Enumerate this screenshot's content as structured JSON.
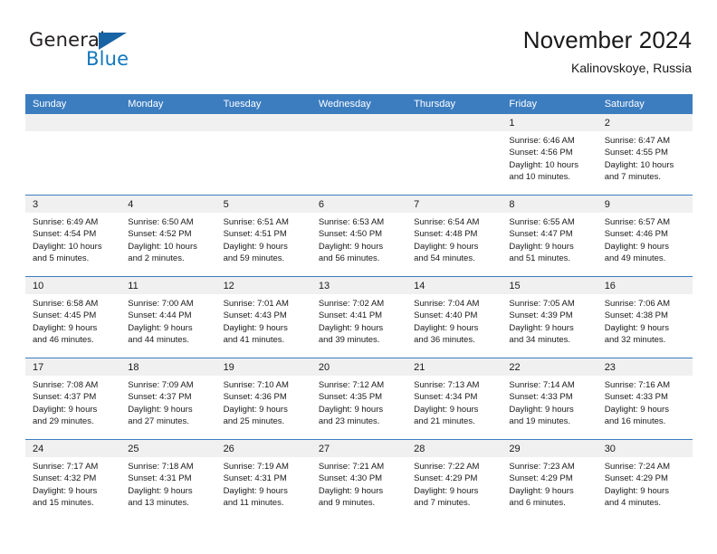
{
  "brand": {
    "name_part1": "General",
    "name_part2": "Blue",
    "triangle_color": "#1763a4",
    "blue_color": "#1278be"
  },
  "header": {
    "title": "November 2024",
    "subtitle": "Kalinovskoye, Russia"
  },
  "theme": {
    "header_blue": "#3c7dc0",
    "daynum_band": "#f0f0f0",
    "text": "#1a1a1a"
  },
  "weekdays": [
    "Sunday",
    "Monday",
    "Tuesday",
    "Wednesday",
    "Thursday",
    "Friday",
    "Saturday"
  ],
  "weeks": [
    [
      {
        "day": "",
        "sunrise": "",
        "sunset": "",
        "daylight": ""
      },
      {
        "day": "",
        "sunrise": "",
        "sunset": "",
        "daylight": ""
      },
      {
        "day": "",
        "sunrise": "",
        "sunset": "",
        "daylight": ""
      },
      {
        "day": "",
        "sunrise": "",
        "sunset": "",
        "daylight": ""
      },
      {
        "day": "",
        "sunrise": "",
        "sunset": "",
        "daylight": ""
      },
      {
        "day": "1",
        "sunrise": "Sunrise: 6:46 AM",
        "sunset": "Sunset: 4:56 PM",
        "daylight": "Daylight: 10 hours and 10 minutes."
      },
      {
        "day": "2",
        "sunrise": "Sunrise: 6:47 AM",
        "sunset": "Sunset: 4:55 PM",
        "daylight": "Daylight: 10 hours and 7 minutes."
      }
    ],
    [
      {
        "day": "3",
        "sunrise": "Sunrise: 6:49 AM",
        "sunset": "Sunset: 4:54 PM",
        "daylight": "Daylight: 10 hours and 5 minutes."
      },
      {
        "day": "4",
        "sunrise": "Sunrise: 6:50 AM",
        "sunset": "Sunset: 4:52 PM",
        "daylight": "Daylight: 10 hours and 2 minutes."
      },
      {
        "day": "5",
        "sunrise": "Sunrise: 6:51 AM",
        "sunset": "Sunset: 4:51 PM",
        "daylight": "Daylight: 9 hours and 59 minutes."
      },
      {
        "day": "6",
        "sunrise": "Sunrise: 6:53 AM",
        "sunset": "Sunset: 4:50 PM",
        "daylight": "Daylight: 9 hours and 56 minutes."
      },
      {
        "day": "7",
        "sunrise": "Sunrise: 6:54 AM",
        "sunset": "Sunset: 4:48 PM",
        "daylight": "Daylight: 9 hours and 54 minutes."
      },
      {
        "day": "8",
        "sunrise": "Sunrise: 6:55 AM",
        "sunset": "Sunset: 4:47 PM",
        "daylight": "Daylight: 9 hours and 51 minutes."
      },
      {
        "day": "9",
        "sunrise": "Sunrise: 6:57 AM",
        "sunset": "Sunset: 4:46 PM",
        "daylight": "Daylight: 9 hours and 49 minutes."
      }
    ],
    [
      {
        "day": "10",
        "sunrise": "Sunrise: 6:58 AM",
        "sunset": "Sunset: 4:45 PM",
        "daylight": "Daylight: 9 hours and 46 minutes."
      },
      {
        "day": "11",
        "sunrise": "Sunrise: 7:00 AM",
        "sunset": "Sunset: 4:44 PM",
        "daylight": "Daylight: 9 hours and 44 minutes."
      },
      {
        "day": "12",
        "sunrise": "Sunrise: 7:01 AM",
        "sunset": "Sunset: 4:43 PM",
        "daylight": "Daylight: 9 hours and 41 minutes."
      },
      {
        "day": "13",
        "sunrise": "Sunrise: 7:02 AM",
        "sunset": "Sunset: 4:41 PM",
        "daylight": "Daylight: 9 hours and 39 minutes."
      },
      {
        "day": "14",
        "sunrise": "Sunrise: 7:04 AM",
        "sunset": "Sunset: 4:40 PM",
        "daylight": "Daylight: 9 hours and 36 minutes."
      },
      {
        "day": "15",
        "sunrise": "Sunrise: 7:05 AM",
        "sunset": "Sunset: 4:39 PM",
        "daylight": "Daylight: 9 hours and 34 minutes."
      },
      {
        "day": "16",
        "sunrise": "Sunrise: 7:06 AM",
        "sunset": "Sunset: 4:38 PM",
        "daylight": "Daylight: 9 hours and 32 minutes."
      }
    ],
    [
      {
        "day": "17",
        "sunrise": "Sunrise: 7:08 AM",
        "sunset": "Sunset: 4:37 PM",
        "daylight": "Daylight: 9 hours and 29 minutes."
      },
      {
        "day": "18",
        "sunrise": "Sunrise: 7:09 AM",
        "sunset": "Sunset: 4:37 PM",
        "daylight": "Daylight: 9 hours and 27 minutes."
      },
      {
        "day": "19",
        "sunrise": "Sunrise: 7:10 AM",
        "sunset": "Sunset: 4:36 PM",
        "daylight": "Daylight: 9 hours and 25 minutes."
      },
      {
        "day": "20",
        "sunrise": "Sunrise: 7:12 AM",
        "sunset": "Sunset: 4:35 PM",
        "daylight": "Daylight: 9 hours and 23 minutes."
      },
      {
        "day": "21",
        "sunrise": "Sunrise: 7:13 AM",
        "sunset": "Sunset: 4:34 PM",
        "daylight": "Daylight: 9 hours and 21 minutes."
      },
      {
        "day": "22",
        "sunrise": "Sunrise: 7:14 AM",
        "sunset": "Sunset: 4:33 PM",
        "daylight": "Daylight: 9 hours and 19 minutes."
      },
      {
        "day": "23",
        "sunrise": "Sunrise: 7:16 AM",
        "sunset": "Sunset: 4:33 PM",
        "daylight": "Daylight: 9 hours and 16 minutes."
      }
    ],
    [
      {
        "day": "24",
        "sunrise": "Sunrise: 7:17 AM",
        "sunset": "Sunset: 4:32 PM",
        "daylight": "Daylight: 9 hours and 15 minutes."
      },
      {
        "day": "25",
        "sunrise": "Sunrise: 7:18 AM",
        "sunset": "Sunset: 4:31 PM",
        "daylight": "Daylight: 9 hours and 13 minutes."
      },
      {
        "day": "26",
        "sunrise": "Sunrise: 7:19 AM",
        "sunset": "Sunset: 4:31 PM",
        "daylight": "Daylight: 9 hours and 11 minutes."
      },
      {
        "day": "27",
        "sunrise": "Sunrise: 7:21 AM",
        "sunset": "Sunset: 4:30 PM",
        "daylight": "Daylight: 9 hours and 9 minutes."
      },
      {
        "day": "28",
        "sunrise": "Sunrise: 7:22 AM",
        "sunset": "Sunset: 4:29 PM",
        "daylight": "Daylight: 9 hours and 7 minutes."
      },
      {
        "day": "29",
        "sunrise": "Sunrise: 7:23 AM",
        "sunset": "Sunset: 4:29 PM",
        "daylight": "Daylight: 9 hours and 6 minutes."
      },
      {
        "day": "30",
        "sunrise": "Sunrise: 7:24 AM",
        "sunset": "Sunset: 4:29 PM",
        "daylight": "Daylight: 9 hours and 4 minutes."
      }
    ]
  ]
}
